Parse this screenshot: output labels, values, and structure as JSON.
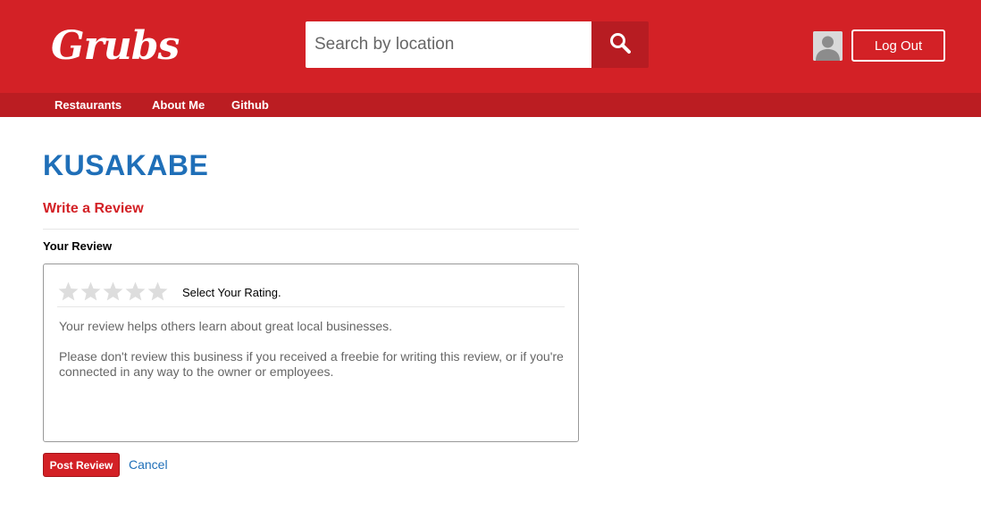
{
  "header": {
    "logo_text": "Grubs",
    "search": {
      "placeholder": "Search by location"
    },
    "search_icon": "magnifier-icon",
    "avatar_icon": "user-silhouette-icon",
    "logout_label": "Log Out"
  },
  "nav": {
    "items": [
      {
        "label": "Restaurants"
      },
      {
        "label": "About Me"
      },
      {
        "label": "Github"
      }
    ]
  },
  "business": {
    "name": "KUSAKABE"
  },
  "review_form": {
    "title": "Write a Review",
    "field_label": "Your Review",
    "rating": {
      "max": 5,
      "value": 0,
      "label": "Select Your Rating."
    },
    "help_text_1": "Your review helps others learn about great local businesses.",
    "help_text_2": "Please don't review this business if you received a freebie for writing this review, or if you're connected in any way to the owner or employees.",
    "submit_label": "Post Review",
    "cancel_label": "Cancel"
  },
  "colors": {
    "brand_red": "#d32126",
    "subnav_red": "#bb1d22",
    "link_blue": "#1f6fb8",
    "star_empty": "#dddddd"
  }
}
